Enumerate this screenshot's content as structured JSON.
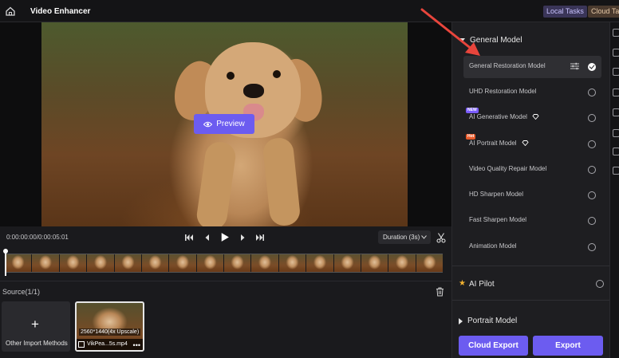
{
  "titlebar": {
    "app_title": "Video Enhancer",
    "local_tasks": "Local Tasks",
    "cloud_tasks": "Cloud Tas"
  },
  "preview": {
    "button_label": "Preview"
  },
  "playback": {
    "timecode": "0:00:00:00/0:00:05:01",
    "duration_select": "Duration (3s)"
  },
  "source": {
    "label": "Source(1/1)",
    "import_label": "Other Import Methods",
    "clip_resolution": "2560*1440(4x Upscale)",
    "clip_name": "VikPea...5s.mp4"
  },
  "panel": {
    "general_model_heading": "General Model",
    "models": [
      {
        "label": "General Restoration Model",
        "selected": true
      },
      {
        "label": "UHD Restoration Model",
        "selected": false
      },
      {
        "label": "AI Generative Model",
        "selected": false,
        "badge": "NEW"
      },
      {
        "label": "AI Portrait Model",
        "selected": false,
        "badge": "Hot"
      },
      {
        "label": "Video Quality Repair Model",
        "selected": false
      },
      {
        "label": "HD Sharpen Model",
        "selected": false
      },
      {
        "label": "Fast Sharpen Model",
        "selected": false
      },
      {
        "label": "Animation Model",
        "selected": false
      }
    ],
    "ai_pilot": "AI Pilot",
    "portrait_model_heading": "Portrait Model"
  },
  "actions": {
    "cloud_export": "Cloud Export",
    "export": "Export"
  },
  "colors": {
    "accent": "#6c5cf0",
    "annotation_arrow": "#e8453c",
    "panel_bg": "#1e1e21"
  }
}
